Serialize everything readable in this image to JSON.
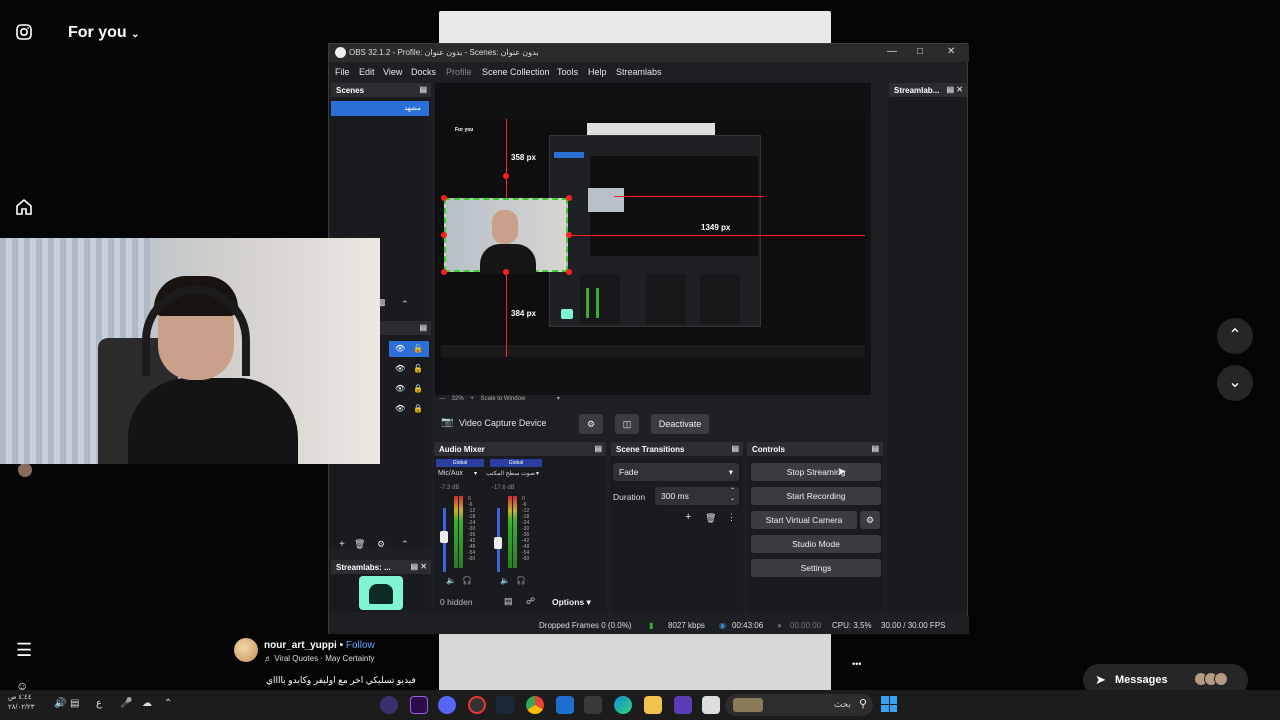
{
  "instagram": {
    "header_title": "For you",
    "user": {
      "name": "nour_art_yuppi",
      "follow": "Follow",
      "separator": "•",
      "song": "♬ Viral Quotes · May Certainty"
    },
    "caption": "فيديو تسليكي اخر مع اوليفر وكايدو يااااي",
    "messages_label": "Messages",
    "more": "•••"
  },
  "obs": {
    "title": "OBS 32.1.2 - Profile: بدون عنوان - Scenes: بدون عنوان",
    "menu": [
      "File",
      "Edit",
      "View",
      "Docks",
      "Profile",
      "Scene Collection",
      "Tools",
      "Help",
      "Streamlabs"
    ],
    "scenes": {
      "header": "Scenes",
      "items": [
        "مشهد"
      ]
    },
    "preview": {
      "foryou": "For you",
      "dist_top": "358 px",
      "dist_right": "1349 px",
      "dist_bottom": "384 px",
      "zoom": "32%",
      "scale_mode": "Scale to Window"
    },
    "source_bar": {
      "name": "Video Capture Device",
      "deactivate": "Deactivate"
    },
    "audio_mixer": {
      "header": "Audio Mixer",
      "channels": [
        {
          "tag": "Global",
          "name": "Mic/Aux",
          "db": "-7.3 dB",
          "level": 0.55
        },
        {
          "tag": "Global",
          "name": "صوت سطح المكتب",
          "db": "-17.6 dB",
          "level": 0.45
        }
      ],
      "scale": [
        "0",
        "-6",
        "-12",
        "-18",
        "-24",
        "-30",
        "-36",
        "-42",
        "-48",
        "-54",
        "-60"
      ],
      "hidden": "0 hidden",
      "options": "Options"
    },
    "transitions": {
      "header": "Scene Transitions",
      "type": "Fade",
      "duration_label": "Duration",
      "duration_value": "300 ms"
    },
    "controls": {
      "header": "Controls",
      "buttons": [
        "Stop Streaming",
        "Start Recording",
        "Start Virtual Camera",
        "Studio Mode",
        "Settings"
      ]
    },
    "streamlabs_dock": {
      "header": "Streamlabs: ...",
      "side_header": "Streamlab..."
    },
    "status": {
      "dropped": "Dropped Frames 0 (0.0%)",
      "bitrate": "8027 kbps",
      "stream_time": "00:43:06",
      "record_time": "00:00:00",
      "cpu": "CPU: 3.5%",
      "fps": "30.00 / 30.00 FPS"
    }
  },
  "taskbar": {
    "search_label": "بحث",
    "clock_time": "٤:٤٤ ص",
    "clock_date": "٢٨/٠٢/٢٣",
    "lang": "ع"
  },
  "colors": {
    "obs_blue": "#2c6fd6",
    "obs_bg": "#1e1f22",
    "red_guide": "#ff1f1f",
    "green_selection": "#3bd12d"
  }
}
